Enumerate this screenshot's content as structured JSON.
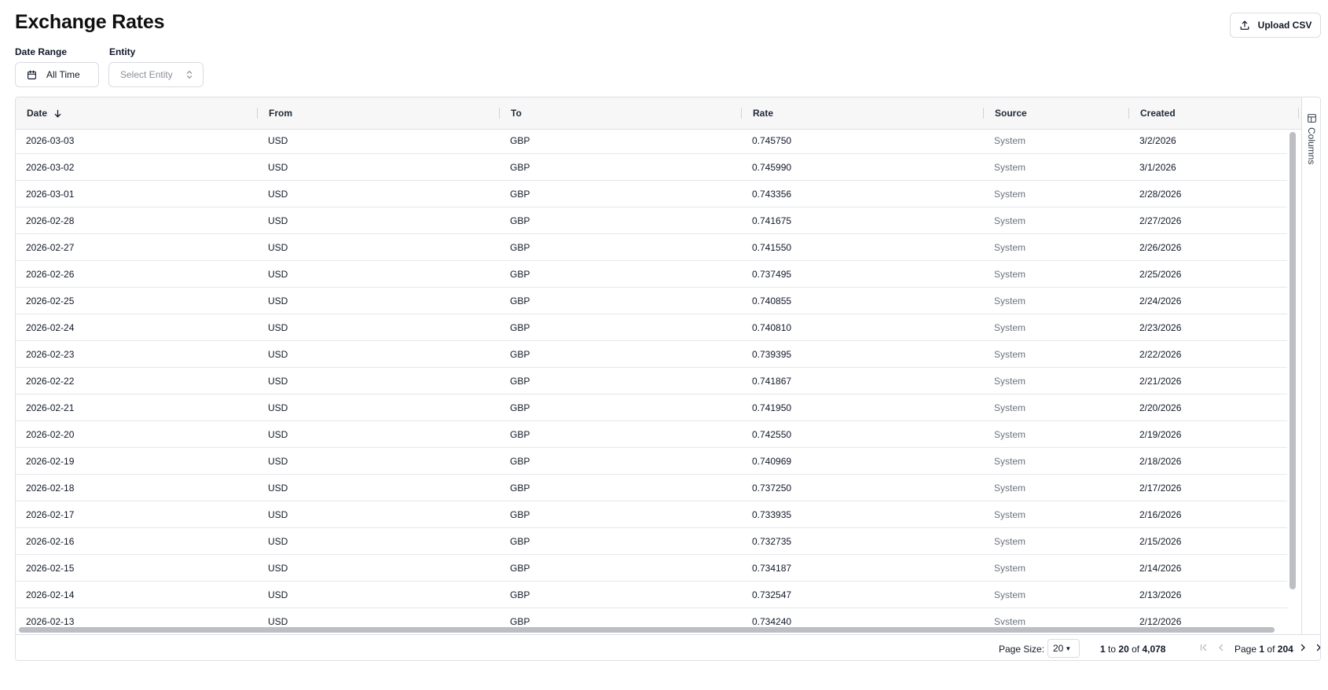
{
  "title": "Exchange Rates",
  "upload_label": "Upload CSV",
  "filters": {
    "date_range_label": "Date Range",
    "date_range_value": "All Time",
    "entity_label": "Entity",
    "entity_placeholder": "Select Entity"
  },
  "columns": [
    "Date",
    "From",
    "To",
    "Rate",
    "Source",
    "Created"
  ],
  "sort": {
    "column": "Date",
    "direction": "desc"
  },
  "rows": [
    [
      "2026-03-03",
      "USD",
      "GBP",
      "0.745750",
      "System",
      "3/2/2026"
    ],
    [
      "2026-03-02",
      "USD",
      "GBP",
      "0.745990",
      "System",
      "3/1/2026"
    ],
    [
      "2026-03-01",
      "USD",
      "GBP",
      "0.743356",
      "System",
      "2/28/2026"
    ],
    [
      "2026-02-28",
      "USD",
      "GBP",
      "0.741675",
      "System",
      "2/27/2026"
    ],
    [
      "2026-02-27",
      "USD",
      "GBP",
      "0.741550",
      "System",
      "2/26/2026"
    ],
    [
      "2026-02-26",
      "USD",
      "GBP",
      "0.737495",
      "System",
      "2/25/2026"
    ],
    [
      "2026-02-25",
      "USD",
      "GBP",
      "0.740855",
      "System",
      "2/24/2026"
    ],
    [
      "2026-02-24",
      "USD",
      "GBP",
      "0.740810",
      "System",
      "2/23/2026"
    ],
    [
      "2026-02-23",
      "USD",
      "GBP",
      "0.739395",
      "System",
      "2/22/2026"
    ],
    [
      "2026-02-22",
      "USD",
      "GBP",
      "0.741867",
      "System",
      "2/21/2026"
    ],
    [
      "2026-02-21",
      "USD",
      "GBP",
      "0.741950",
      "System",
      "2/20/2026"
    ],
    [
      "2026-02-20",
      "USD",
      "GBP",
      "0.742550",
      "System",
      "2/19/2026"
    ],
    [
      "2026-02-19",
      "USD",
      "GBP",
      "0.740969",
      "System",
      "2/18/2026"
    ],
    [
      "2026-02-18",
      "USD",
      "GBP",
      "0.737250",
      "System",
      "2/17/2026"
    ],
    [
      "2026-02-17",
      "USD",
      "GBP",
      "0.733935",
      "System",
      "2/16/2026"
    ],
    [
      "2026-02-16",
      "USD",
      "GBP",
      "0.732735",
      "System",
      "2/15/2026"
    ],
    [
      "2026-02-15",
      "USD",
      "GBP",
      "0.734187",
      "System",
      "2/14/2026"
    ],
    [
      "2026-02-14",
      "USD",
      "GBP",
      "0.732547",
      "System",
      "2/13/2026"
    ],
    [
      "2026-02-13",
      "USD",
      "GBP",
      "0.734240",
      "System",
      "2/12/2026"
    ]
  ],
  "side_panel_label": "Columns",
  "pagination": {
    "page_size_label": "Page Size:",
    "page_size": "20",
    "row_from": "1",
    "row_to": "20",
    "row_total": "4,078",
    "row_to_word": "to",
    "row_of_word": "of",
    "page_word": "Page",
    "page_current": "1",
    "page_of_word": "of",
    "page_total": "204"
  },
  "icons": {
    "upload": "upload-icon",
    "calendar": "calendar-icon",
    "selector": "chevron-up-down-icon",
    "sort": "arrow-down-icon",
    "columns": "table-columns-icon",
    "first": "first-page-icon",
    "prev": "prev-page-icon",
    "next": "next-page-icon",
    "last": "last-page-icon"
  }
}
